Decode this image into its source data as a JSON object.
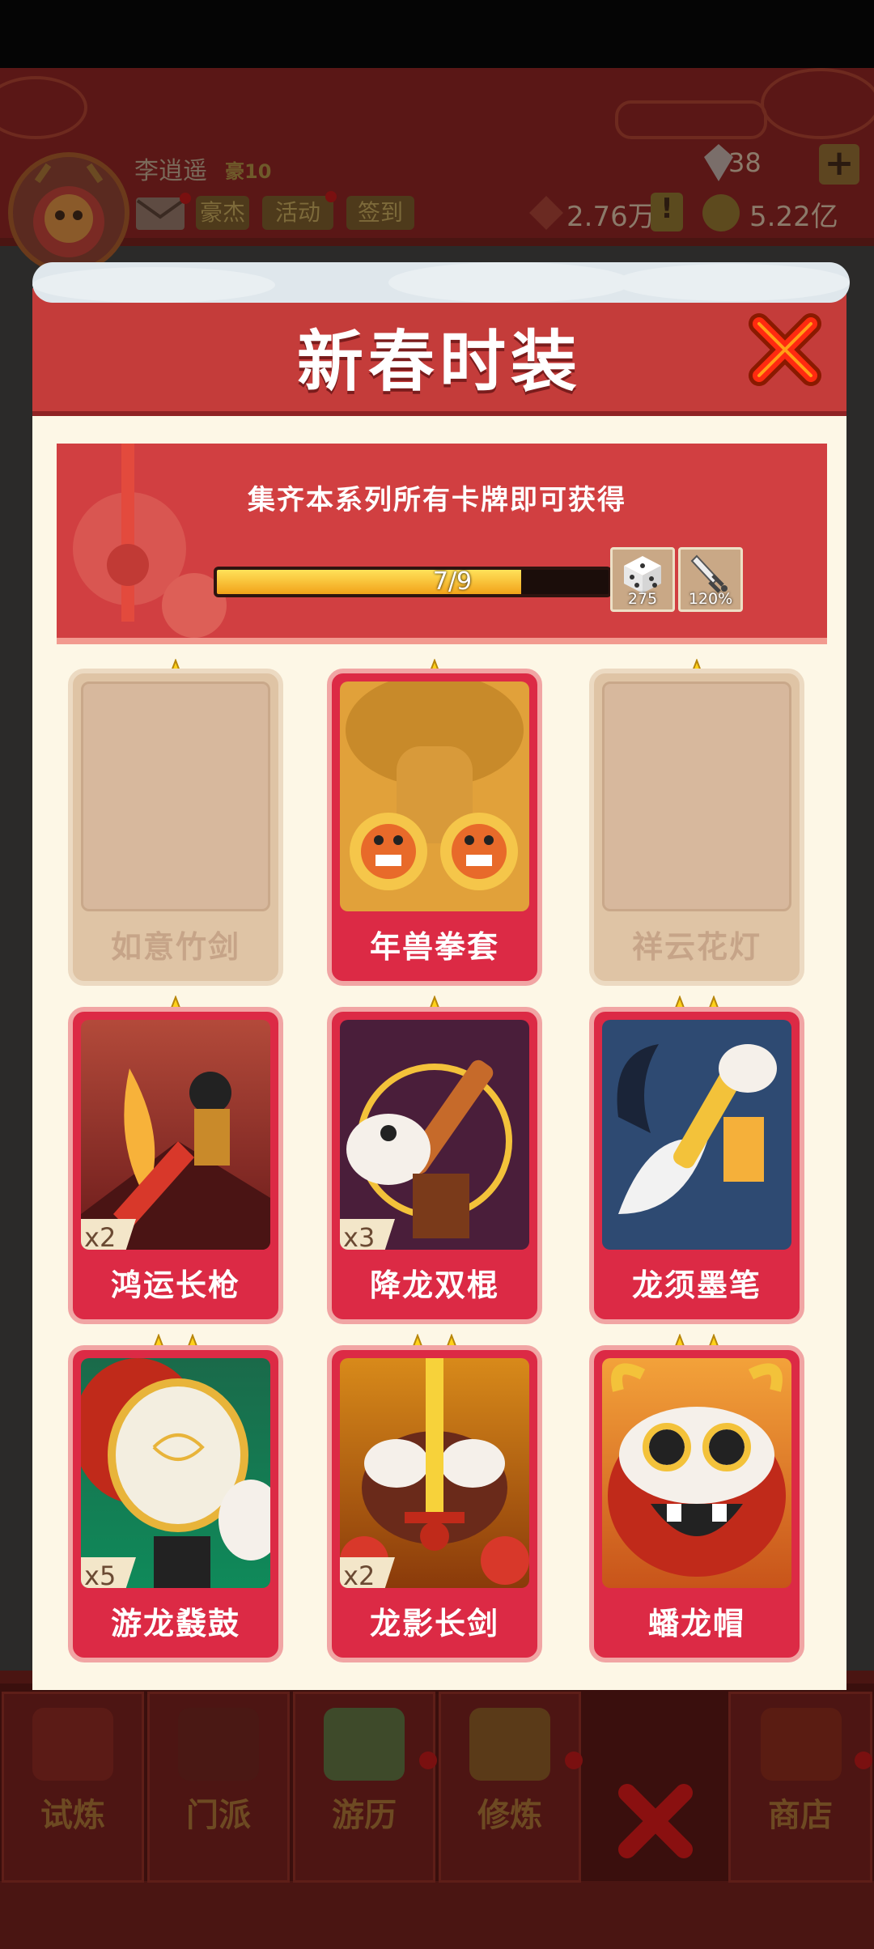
{
  "player": {
    "name": "李逍遥",
    "rank": "豪10"
  },
  "header_buttons": [
    "豪杰",
    "活动",
    "签到"
  ],
  "currency": {
    "gems": "38",
    "silver": "2.76万",
    "gold": "5.22亿"
  },
  "modal": {
    "title": "新春时装",
    "banner_text": "集齐本系列所有卡牌即可获得",
    "progress": {
      "label": "7/9",
      "current": 7,
      "total": 9
    },
    "rewards": [
      {
        "icon": "dice-icon",
        "value": "275"
      },
      {
        "icon": "sword-icon",
        "value": "120%"
      }
    ]
  },
  "cards": [
    {
      "name": "如意竹剑",
      "stars": 1,
      "owned": false,
      "count": ""
    },
    {
      "name": "年兽拳套",
      "stars": 1,
      "owned": true,
      "count": ""
    },
    {
      "name": "祥云花灯",
      "stars": 1,
      "owned": false,
      "count": ""
    },
    {
      "name": "鸿运长枪",
      "stars": 1,
      "owned": true,
      "count": "x2"
    },
    {
      "name": "降龙双棍",
      "stars": 1,
      "owned": true,
      "count": "x3"
    },
    {
      "name": "龙须墨笔",
      "stars": 2,
      "owned": true,
      "count": ""
    },
    {
      "name": "游龙鼗鼓",
      "stars": 2,
      "owned": true,
      "count": "x5"
    },
    {
      "name": "龙影长剑",
      "stars": 2,
      "owned": true,
      "count": "x2"
    },
    {
      "name": "蟠龙帽",
      "stars": 2,
      "owned": true,
      "count": ""
    }
  ],
  "bottom_nav": [
    "试炼",
    "门派",
    "游历",
    "修炼",
    "",
    "商店"
  ],
  "colors": {
    "accent_red": "#c43c3a",
    "card_red": "#dc2a45",
    "progress_gold": "#f2a219",
    "panel_cream": "#fdf7e6"
  }
}
